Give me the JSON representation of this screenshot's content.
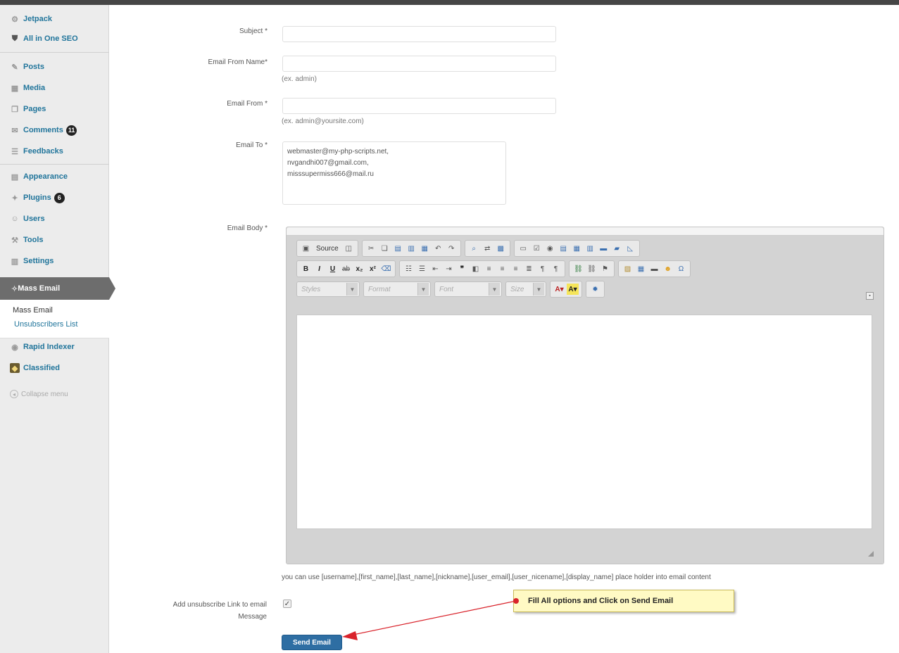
{
  "sidebar": {
    "items": [
      {
        "label": "Jetpack",
        "icon": "jetpack-icon"
      },
      {
        "label": "All in One SEO",
        "icon": "seo-shield-icon"
      },
      {
        "label": "Posts",
        "icon": "pin-icon"
      },
      {
        "label": "Media",
        "icon": "media-icon"
      },
      {
        "label": "Pages",
        "icon": "pages-icon"
      },
      {
        "label": "Comments",
        "icon": "comment-icon",
        "badge": "11"
      },
      {
        "label": "Feedbacks",
        "icon": "feedback-icon"
      },
      {
        "label": "Appearance",
        "icon": "appearance-icon"
      },
      {
        "label": "Plugins",
        "icon": "plugin-icon",
        "badge": "6"
      },
      {
        "label": "Users",
        "icon": "users-icon"
      },
      {
        "label": "Tools",
        "icon": "tools-icon"
      },
      {
        "label": "Settings",
        "icon": "settings-icon"
      }
    ],
    "active": {
      "label": "Mass Email",
      "icon": "mass-email-icon"
    },
    "submenu": [
      "Mass Email",
      "Unsubscribers List"
    ],
    "after": [
      {
        "label": "Rapid Indexer",
        "icon": "indexer-icon"
      },
      {
        "label": "Classified",
        "icon": "classified-icon"
      }
    ],
    "collapse": "Collapse menu"
  },
  "form": {
    "subject_label": "Subject *",
    "from_name_label": "Email From Name*",
    "from_name_hint": "(ex. admin)",
    "from_label": "Email From *",
    "from_hint": "(ex. admin@yoursite.com)",
    "to_label": "Email To *",
    "to_lines": [
      "webmaster@my-php-scripts.net,",
      "nvgandhi007@gmail.com,",
      "misssupermiss666@mail.ru"
    ],
    "body_label": "Email Body *",
    "placeholder_note": "you can use [username],[first_name],[last_name],[nickname],[user_email],[user_nicename],[display_name] place holder into email content",
    "unsub_label_line1": "Add unsubscribe Link to email",
    "unsub_label_line2": "Message",
    "unsub_checked": "✓",
    "send_label": "Send Email"
  },
  "editor": {
    "source_label": "Source",
    "styles": "Styles",
    "format": "Format",
    "font": "Font",
    "size": "Size"
  },
  "callout": {
    "text": "Fill All options and Click on Send Email",
    "arrow_color": "#d9232b"
  }
}
